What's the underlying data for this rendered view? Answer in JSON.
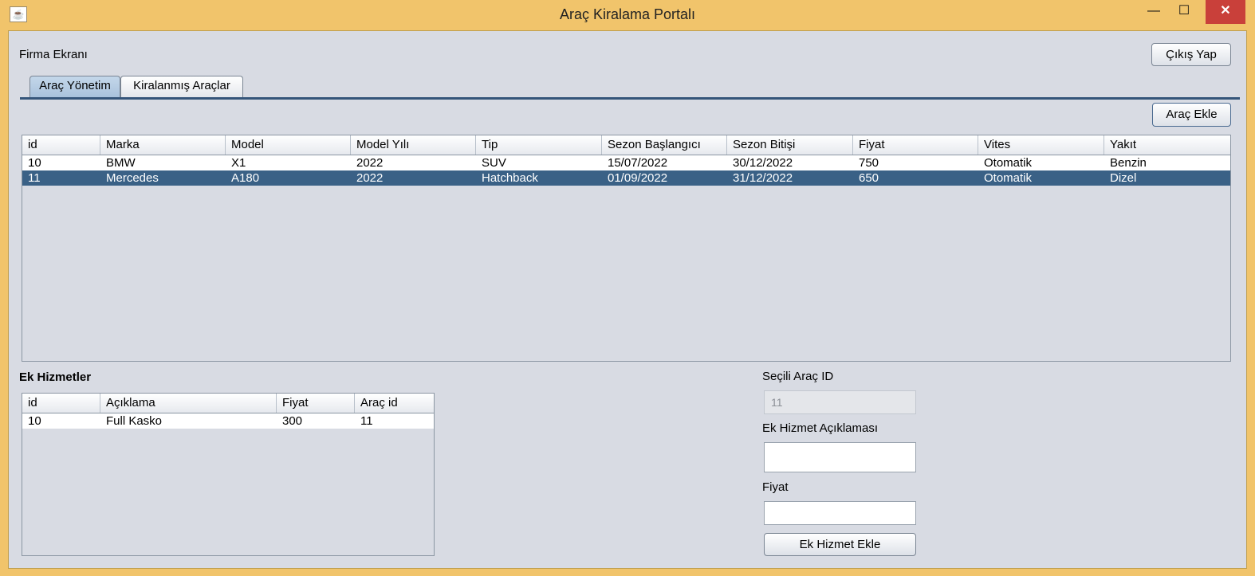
{
  "window": {
    "title": "Araç Kiralama Portalı",
    "app_icon_glyph": "☕",
    "minimize_glyph": "—",
    "maximize_glyph": "☐",
    "close_glyph": "✕"
  },
  "header": {
    "screen_label": "Firma Ekranı",
    "logout_label": "Çıkış Yap"
  },
  "tabs": [
    {
      "label": "Araç Yönetim",
      "active": true
    },
    {
      "label": "Kiralanmış Araçlar",
      "active": false
    }
  ],
  "toolbar": {
    "add_car_label": "Araç Ekle"
  },
  "cars_table": {
    "columns": [
      "id",
      "Marka",
      "Model",
      "Model Yılı",
      "Tip",
      "Sezon Başlangıcı",
      "Sezon Bitişi",
      "Fiyat",
      "Vites",
      "Yakıt"
    ],
    "rows": [
      [
        "10",
        "BMW",
        "X1",
        "2022",
        "SUV",
        "15/07/2022",
        "30/12/2022",
        "750",
        "Otomatik",
        "Benzin"
      ],
      [
        "11",
        "Mercedes",
        "A180",
        "2022",
        "Hatchback",
        "01/09/2022",
        "31/12/2022",
        "650",
        "Otomatik",
        "Dizel"
      ]
    ],
    "selected_row": 1
  },
  "extras": {
    "title": "Ek Hizmetler",
    "columns": [
      "id",
      "Açıklama",
      "Fiyat",
      "Araç id"
    ],
    "rows": [
      [
        "10",
        "Full Kasko",
        "300",
        "11"
      ]
    ]
  },
  "form": {
    "selected_car_label": "Seçili Araç ID",
    "selected_car_value": "11",
    "description_label": "Ek Hizmet Açıklaması",
    "description_value": "",
    "price_label": "Fiyat",
    "price_value": "",
    "submit_label": "Ek Hizmet Ekle"
  },
  "colors": {
    "window_frame": "#f1c46b",
    "client_bg": "#d8dbe3",
    "selection": "#3a6186",
    "close_button": "#c9403a"
  }
}
